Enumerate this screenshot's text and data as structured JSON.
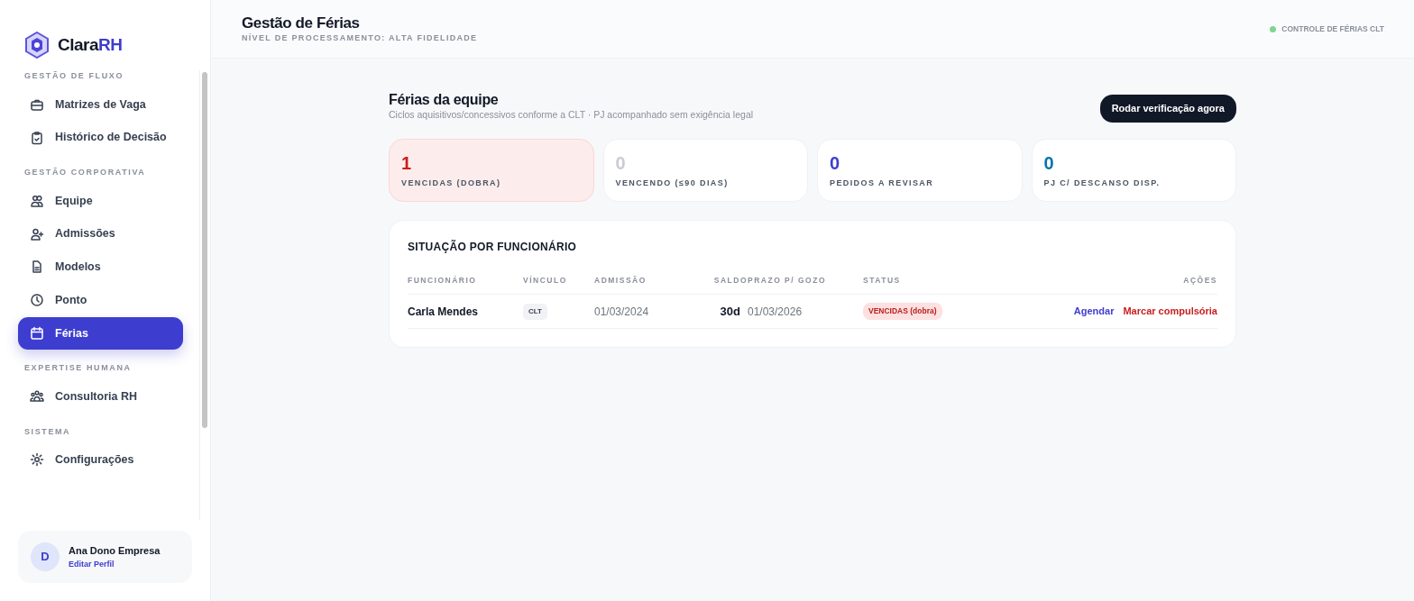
{
  "brand": {
    "name": "Clara",
    "accent": "RH"
  },
  "sidebar": {
    "sections": [
      {
        "title": "GESTÃO DE FLUXO",
        "items": [
          {
            "label": "Matrizes de Vaga",
            "selected": false
          },
          {
            "label": "Histórico de Decisão",
            "selected": false
          }
        ]
      },
      {
        "title": "GESTÃO CORPORATIVA",
        "items": [
          {
            "label": "Equipe",
            "selected": false
          },
          {
            "label": "Admissões",
            "selected": false
          },
          {
            "label": "Modelos",
            "selected": false
          },
          {
            "label": "Ponto",
            "selected": false
          },
          {
            "label": "Férias",
            "selected": true
          }
        ]
      },
      {
        "title": "EXPERTISE HUMANA",
        "items": [
          {
            "label": "Consultoria RH",
            "selected": false
          }
        ]
      },
      {
        "title": "SISTEMA",
        "items": [
          {
            "label": "Configurações",
            "selected": false
          }
        ]
      }
    ]
  },
  "user": {
    "initial": "D",
    "name": "Ana Dono Empresa",
    "link": "Editar Perfil"
  },
  "header": {
    "title": "Gestão de Férias",
    "subtitle": "NÍVEL DE PROCESSAMENTO: ALTA FIDELIDADE",
    "status": "CONTROLE DE FÉRIAS CLT"
  },
  "page": {
    "title": "Férias da equipe",
    "subtitle": "Ciclos aquisitivos/concessivos conforme a CLT · PJ acompanhado sem exigência legal",
    "button": "Rodar verificação agora"
  },
  "stats": [
    {
      "value": "1",
      "label": "VENCIDAS (DOBRA)",
      "color": "#c81e1e",
      "highlighted": true
    },
    {
      "value": "0",
      "label": "VENCENDO (≤90 DIAS)",
      "color": "#c9ccd3",
      "highlighted": false
    },
    {
      "value": "0",
      "label": "PEDIDOS A REVISAR",
      "color": "#3d3dd0",
      "highlighted": false
    },
    {
      "value": "0",
      "label": "PJ C/ DESCANSO DISP.",
      "color": "#0a74a8",
      "highlighted": false
    }
  ],
  "table": {
    "title": "SITUAÇÃO POR FUNCIONÁRIO",
    "columns": [
      "FUNCIONÁRIO",
      "VÍNCULO",
      "ADMISSÃO",
      "SALDO",
      "PRAZO P/ GOZO",
      "STATUS",
      "AÇÕES"
    ],
    "rows": [
      {
        "name": "Carla Mendes",
        "type": "CLT",
        "admission": "01/03/2024",
        "balance": "30d",
        "deadline": "01/03/2026",
        "status": "VENCIDAS (dobra)",
        "actions": [
          {
            "label": "Agendar",
            "kind": "primary"
          },
          {
            "label": "Marcar compulsória",
            "kind": "danger"
          }
        ]
      }
    ]
  }
}
